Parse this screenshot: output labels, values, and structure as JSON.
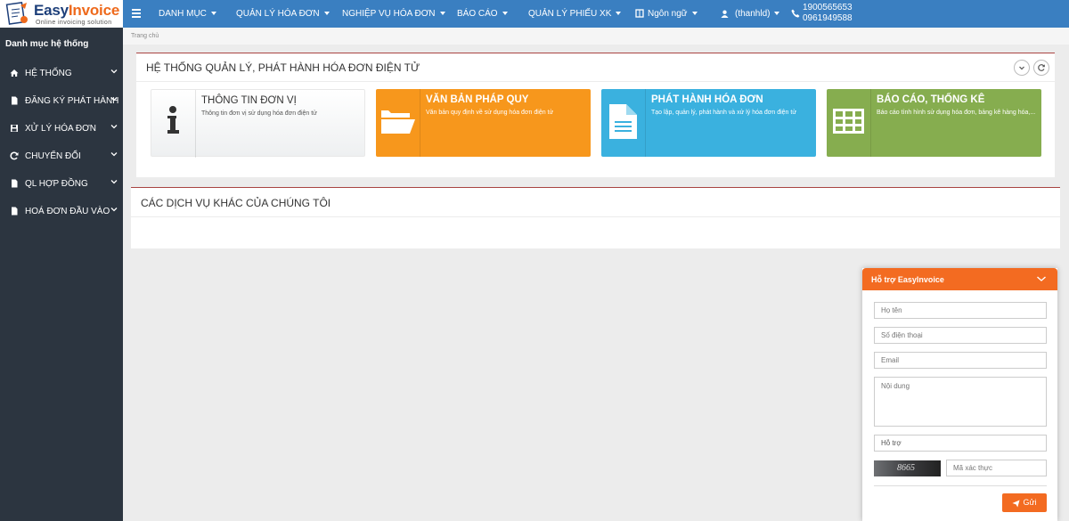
{
  "brand": {
    "name_part1": "Easy",
    "name_part2": "Invoice",
    "tagline": "Online invoicing solution"
  },
  "topnav": {
    "items": [
      {
        "label": "DANH MỤC",
        "icon": "caret-down"
      },
      {
        "label": "QUẢN LÝ HÓA ĐƠN",
        "icon": "caret-down"
      },
      {
        "label": "NGHIỆP VỤ HÓA ĐƠN",
        "icon": "caret-down"
      },
      {
        "label": "BÁO CÁO",
        "icon": "caret-down"
      },
      {
        "label": "QUẢN LÝ PHIẾU XK",
        "icon": "caret-down"
      }
    ],
    "language": "Ngôn ngữ",
    "user": "(thanhld)",
    "phone1": "1900565653",
    "phone2": "0961949588"
  },
  "sidebar": {
    "title": "Danh mục hệ thống",
    "items": [
      {
        "label": "HỆ THỐNG",
        "icon": "home-icon"
      },
      {
        "label": "ĐĂNG KÝ PHÁT HÀNH",
        "icon": "file-icon"
      },
      {
        "label": "XỬ LÝ HÓA ĐƠN",
        "icon": "save-icon"
      },
      {
        "label": "CHUYỂN ĐỔI",
        "icon": "refresh-icon"
      },
      {
        "label": "QL HỢP ĐỒNG",
        "icon": "file-icon"
      },
      {
        "label": "HOÁ ĐƠN ĐẦU VÀO",
        "icon": "file-icon"
      }
    ]
  },
  "breadcrumb": "Trang chủ",
  "main_panel": {
    "title": "HỆ THỐNG QUẢN LÝ, PHÁT HÀNH HÓA ĐƠN ĐIỆN TỬ",
    "tiles": [
      {
        "title": "THÔNG TIN ĐƠN VỊ",
        "desc": "Thông tin đơn vị sử dụng hóa đơn điện tử",
        "icon": "info-icon",
        "color": "#f0f0f0"
      },
      {
        "title": "VĂN BẢN PHÁP QUY",
        "desc": "Văn bản quy định về sử dụng hóa đơn điện tử",
        "icon": "folder-open-icon",
        "color": "#f7971c"
      },
      {
        "title": "PHÁT HÀNH HÓA ĐƠN",
        "desc": "Tạo lập, quản lý, phát hành và xử lý hóa đơn điện tử",
        "icon": "document-icon",
        "color": "#3ab1df"
      },
      {
        "title": "BÁO CÁO, THỐNG KÊ",
        "desc": "Báo cáo tình hình sử dụng hóa đơn, bảng kê hàng hóa,...",
        "icon": "table-icon",
        "color": "#86ad4f"
      }
    ]
  },
  "services_panel": {
    "title": "CÁC DỊCH VỤ KHÁC CỦA CHÚNG TÔI"
  },
  "support": {
    "title": "Hỗ trợ EasyInvoice",
    "name_placeholder": "Họ tên",
    "phone_placeholder": "Số điện thoại",
    "email_placeholder": "Email",
    "content_placeholder": "Nội dung",
    "type_value": "Hỗ trợ",
    "captcha_text": "8665",
    "captcha_placeholder": "Mã xác thực",
    "send_label": "Gửi"
  },
  "colors": {
    "topbar": "#3a7fc1",
    "sidebar": "#2c3540",
    "accent": "#f36b21",
    "panel_border": "#a94442"
  }
}
